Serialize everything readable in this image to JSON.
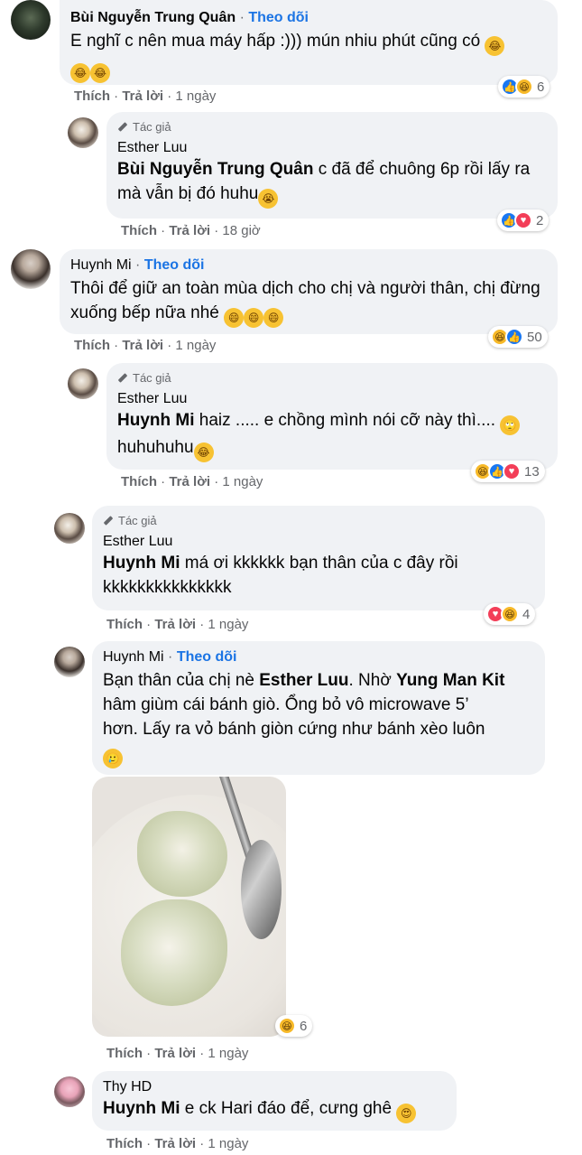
{
  "comments": [
    {
      "name": "Bùi Nguyễn Trung Quân",
      "follow": "Theo dõi",
      "text": "E nghĩ c nên mua máy hấp :))) mún nhiu phút cũng có",
      "reactions": {
        "icons": [
          "like",
          "haha"
        ],
        "count": "6"
      },
      "actions": {
        "like": "Thích",
        "reply": "Trả lời",
        "time": "1 ngày"
      }
    },
    {
      "author_badge": "Tác giả",
      "name": "Esther Luu",
      "mention": "Bùi Nguyễn Trung Quân",
      "text": " c đã để chuông 6p rồi lấy ra mà vẫn bị đó huhu",
      "reactions": {
        "icons": [
          "like",
          "love"
        ],
        "count": "2"
      },
      "actions": {
        "like": "Thích",
        "reply": "Trả lời",
        "time": "18 giờ"
      }
    },
    {
      "name": "Huynh Mi",
      "follow": "Theo dõi",
      "text": "Thôi để giữ an toàn mùa dịch cho chị và người thân, chị đừng xuống bếp nữa nhé",
      "reactions": {
        "icons": [
          "haha",
          "like"
        ],
        "count": "50"
      },
      "actions": {
        "like": "Thích",
        "reply": "Trả lời",
        "time": "1 ngày"
      }
    },
    {
      "author_badge": "Tác giả",
      "name": "Esther Luu",
      "mention": "Huynh Mi",
      "text": " haiz ..... e chồng mình nói cỡ này thì....",
      "text2": "huhuhuhu",
      "reactions": {
        "icons": [
          "haha",
          "like",
          "love"
        ],
        "count": "13"
      },
      "actions": {
        "like": "Thích",
        "reply": "Trả lời",
        "time": "1 ngày"
      }
    },
    {
      "author_badge": "Tác giả",
      "name": "Esther Luu",
      "mention": "Huynh Mi",
      "text": " má ơi kkkkkk bạn thân của c đây rồi",
      "text2": "kkkkkkkkkkkkkkk",
      "reactions": {
        "icons": [
          "love",
          "haha"
        ],
        "count": "4"
      },
      "actions": {
        "like": "Thích",
        "reply": "Trả lời",
        "time": "1 ngày"
      }
    },
    {
      "name": "Huynh Mi",
      "follow": "Theo dõi",
      "text_a": "Bạn thân của chị nè ",
      "mention_a": "Esther Luu",
      "text_b": ". Nhờ ",
      "mention_b": "Yung Man Kit",
      "text_c": "hâm giùm cái bánh giò. Ổng bỏ vô microwave 5’",
      "text_d": "hơn. Lấy ra vỏ bánh giòn cứng như bánh xèo luôn",
      "reactions": {
        "icons": [
          "haha"
        ],
        "count": "6"
      },
      "actions": {
        "like": "Thích",
        "reply": "Trả lời",
        "time": "1 ngày"
      }
    },
    {
      "name": "Thy HD",
      "mention": "Huynh Mi",
      "text": " e ck Hari đáo để, cưng ghê",
      "actions": {
        "like": "Thích",
        "reply": "Trả lời",
        "time": "1 ngày"
      }
    }
  ],
  "separator": "·",
  "colors": {
    "bubble": "#f0f2f5",
    "link": "#1b74e4",
    "meta": "#65676b",
    "like": "#1877f2",
    "love": "#f33e58",
    "haha": "#f7b928"
  },
  "icons": {
    "author": "pen-icon",
    "like": "like-icon",
    "love": "love-icon",
    "haha": "haha-icon"
  }
}
